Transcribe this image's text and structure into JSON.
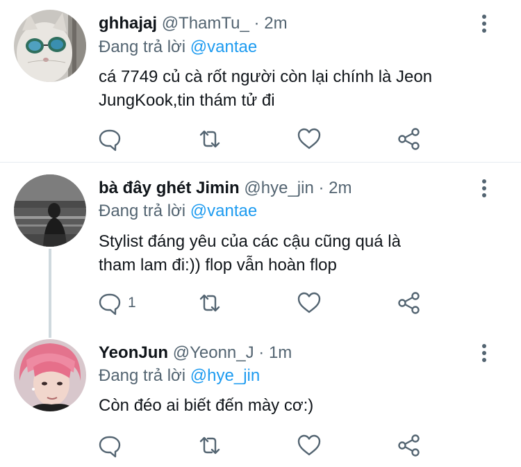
{
  "tweets": [
    {
      "name": "ghhajaj",
      "handle": "@ThamTu_",
      "separator": "·",
      "time": "2m",
      "reply_prefix": "Đang trả lời",
      "reply_to": "@vantae",
      "text_lines": [
        "cá 7749 củ cà rốt người còn lại chính là Jeon",
        "JungKook,tin thám tử đi"
      ],
      "reply_count": "",
      "avatar": "cat-with-sunglasses"
    },
    {
      "name": "bà đây ghét Jimin",
      "handle": "@hye_jin",
      "separator": "·",
      "time": "2m",
      "reply_prefix": "Đang trả lời",
      "reply_to": "@vantae",
      "text_lines": [
        "Stylist đáng yêu của các cậu cũng quá là",
        "tham lam đi:)) flop vẫn hoàn flop"
      ],
      "reply_count": "1",
      "avatar": "dark-portrait"
    },
    {
      "name": "YeonJun",
      "handle": "@Yeonn_J",
      "separator": "·",
      "time": "1m",
      "reply_prefix": "Đang trả lời",
      "reply_to": "@hye_jin",
      "text_lines": [
        "Còn đéo ai biết đến mày cơ:)"
      ],
      "reply_count": "",
      "avatar": "pink-hair-portrait"
    }
  ],
  "icons": {
    "more": "more-vertical-icon",
    "reply": "reply-bubble-icon",
    "retweet": "retweet-icon",
    "like": "heart-icon",
    "share": "share-icon"
  },
  "colors": {
    "accent": "#1d9bf0",
    "secondary_text": "#536471",
    "icon": "#536471",
    "divider": "#e6ecf0",
    "thread_line": "#cfd9de"
  }
}
